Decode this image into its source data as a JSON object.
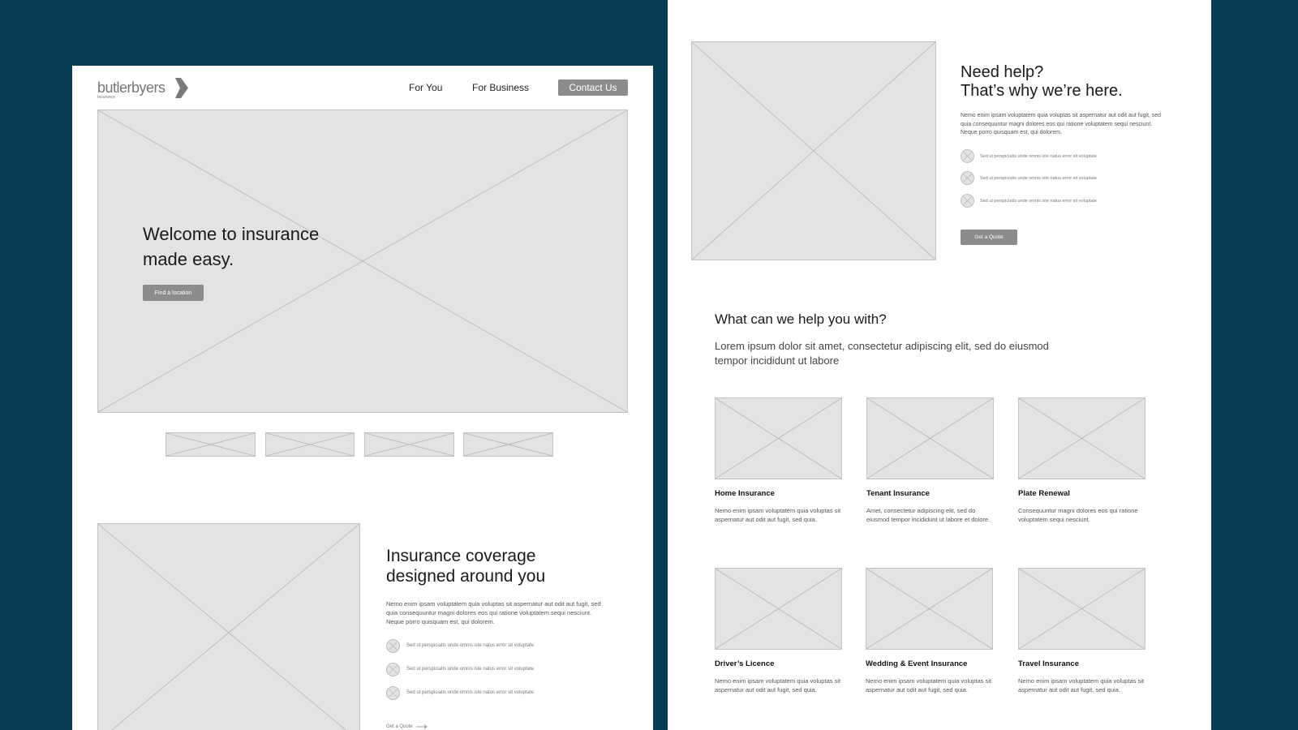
{
  "left_page": {
    "logo": {
      "brand": "butlerbyers",
      "sub": "Insurance"
    },
    "nav": {
      "for_you": "For You",
      "for_business": "For Business",
      "contact": "Contact Us"
    },
    "hero": {
      "title_line1": "Welcome to insurance",
      "title_line2": "made easy.",
      "button": "Find a location"
    },
    "coverage": {
      "title_line1": "Insurance coverage",
      "title_line2": "designed around you",
      "body": "Nemo enim ipsam voluptatem quia voluptas sit aspernatur aut odit aut fugit, sed quia consequuntur magni dolores eos qui ratione voluptatem sequi nesciunt. Neque porro quisquam est, qui dolorem.",
      "bullets": [
        "Sed ut perspiciatis unde omnis iste natus error sit voluptate",
        "Sed ut perspiciatis unde omnis iste natus error sit voluptate",
        "Sed ut perspiciatis unde omnis iste natus error sit voluptate"
      ],
      "link": "Get a Quote"
    }
  },
  "right_page": {
    "help": {
      "title_line1": "Need help?",
      "title_line2": "That’s why we’re here.",
      "body": "Nemo enim ipsam voluptatem quia voluptas sit aspernatur aut odit aut fugit, sed quia consequuntur magni dolores eos qui ratione voluptatem sequi nesciunt. Neque porro quisquam est, qui dolorem.",
      "bullets": [
        "Sed ut perspiciatis unde omnis iste natus error sit voluptate",
        "Sed ut perspiciatis unde omnis iste natus error sit voluptate",
        "Sed ut perspiciatis unde omnis iste natus error sit voluptate"
      ],
      "button": "Get a Quote"
    },
    "services": {
      "title": "What can we help you with?",
      "subtitle_line1": "Lorem ipsum dolor sit amet, consectetur adipiscing elit, sed do eiusmod",
      "subtitle_line2": "tempor incididunt ut labore",
      "cards": [
        {
          "title": "Home Insurance",
          "desc1": "Nemo enim ipsam voluptatem quia voluptas sit",
          "desc2": "aspernatur aut odit aut fugit, sed quia."
        },
        {
          "title": "Tenant Insurance",
          "desc1": "Amet, consectetur adipiscing elit, sed do",
          "desc2": "eiusmod tempor incididunt ut labore et dolore."
        },
        {
          "title": "Plate Renewal",
          "desc1": "Consequuntur magni dolores eos qui ratione",
          "desc2": "voluptatem sequi nesciunt."
        },
        {
          "title": "Driver’s Licence",
          "desc1": "Nemo enim ipsam voluptatem quia voluptas sit",
          "desc2": "aspernatur aut odit aut fugit, sed quia."
        },
        {
          "title": "Wedding & Event Insurance",
          "desc1": "Nemo enim ipsam voluptatem quia voluptas sit",
          "desc2": "aspernatur aut odit aut fugit, sed quia."
        },
        {
          "title": "Travel Insurance",
          "desc1": "Nemo enim ipsam voluptatem quia voluptas sit",
          "desc2": "aspernatur aut odit aut fugit, sed quia."
        }
      ]
    }
  },
  "colors": {
    "background": "#083b54",
    "button_grey": "#8c8c8c",
    "placeholder": "#e3e3e3"
  }
}
